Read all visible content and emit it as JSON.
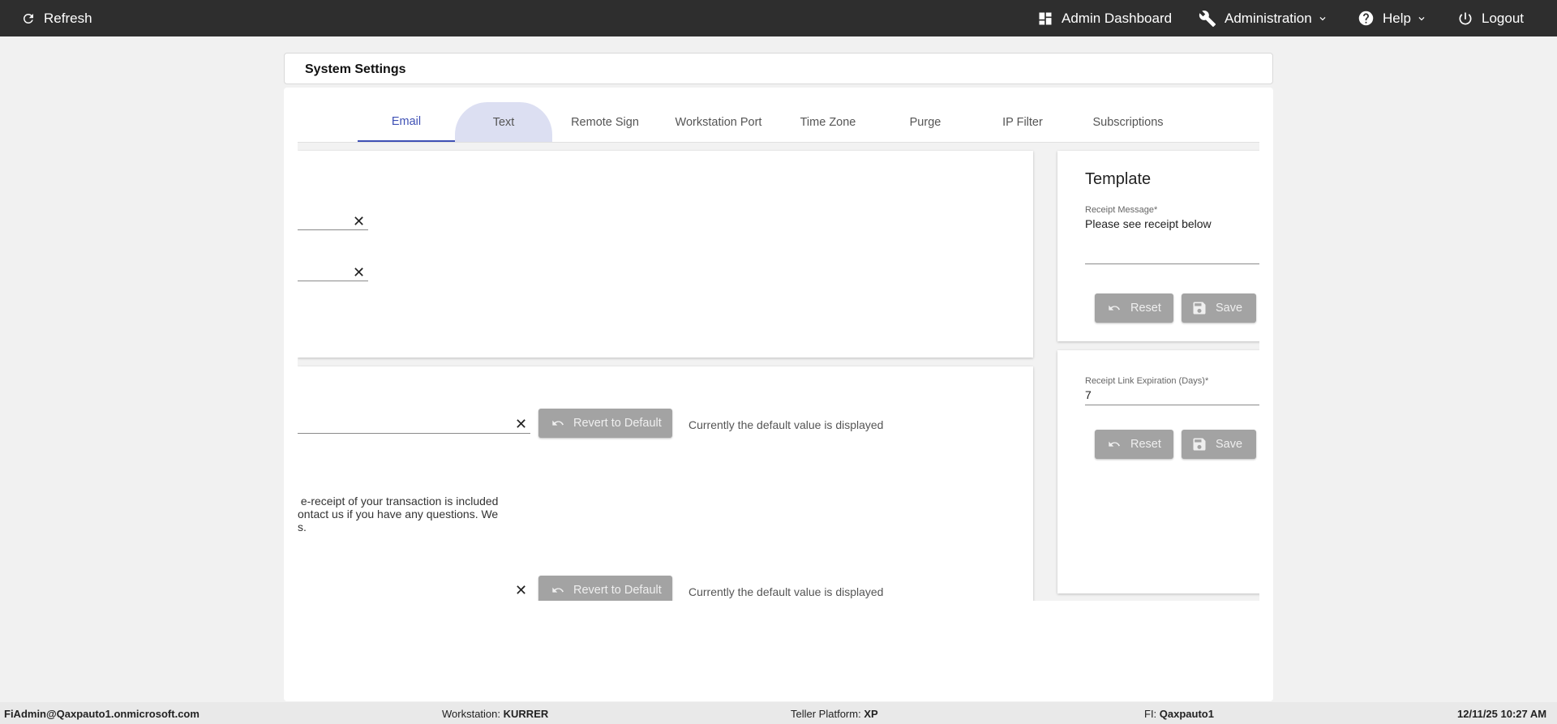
{
  "topbar": {
    "refresh": "Refresh",
    "admin_dashboard": "Admin Dashboard",
    "administration": "Administration",
    "help": "Help",
    "logout": "Logout"
  },
  "page": {
    "title": "System Settings"
  },
  "tabs": [
    {
      "label": "Email",
      "state": "active"
    },
    {
      "label": "Text",
      "state": "hover"
    },
    {
      "label": "Remote Sign"
    },
    {
      "label": "Workstation Port"
    },
    {
      "label": "Time Zone"
    },
    {
      "label": "Purge"
    },
    {
      "label": "IP Filter"
    },
    {
      "label": "Subscriptions"
    }
  ],
  "left_top_card": {
    "clear_glyph": "✕"
  },
  "left_bottom_card": {
    "revert_label": "Revert to Default",
    "hint": "Currently the default value is displayed",
    "message_lines": [
      " e-receipt of your transaction is included",
      "ontact us if you have any questions. We",
      "s."
    ],
    "revert_label_2": "Revert to Default",
    "hint_2": "Currently the default value is displayed"
  },
  "template_card": {
    "heading": "Template",
    "receipt_message_label": "Receipt Message*",
    "receipt_message_value": "Please see receipt below",
    "reset_label": "Reset",
    "save_label": "Save"
  },
  "expiration_card": {
    "label": "Receipt Link Expiration (Days)*",
    "value": "7",
    "reset_label": "Reset",
    "save_label": "Save"
  },
  "footer": {
    "user": "FiAdmin@Qaxpauto1.onmicrosoft.com",
    "workstation_label": "Workstation:",
    "workstation_value": "KURRER",
    "platform_label": "Teller Platform:",
    "platform_value": "XP",
    "fi_label": "FI:",
    "fi_value": "Qaxpauto1",
    "datetime": "12/11/25 10:27 AM"
  },
  "colors": {
    "topbar": "#2e2e2e",
    "accent": "#3f51b5",
    "button_disabled": "#a3a3a3"
  }
}
